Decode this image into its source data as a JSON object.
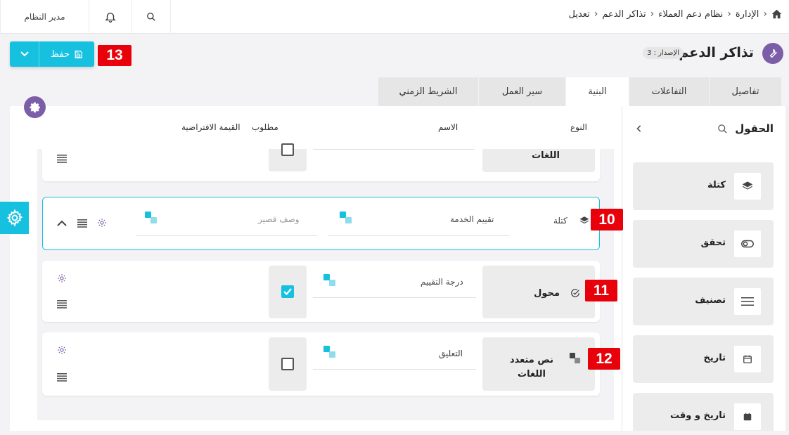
{
  "breadcrumbs": [
    "الإدارة",
    "نظام دعم العملاء",
    "تذاكر الدعم",
    "تعديل"
  ],
  "topbar": {
    "user_label": "مدير النظام"
  },
  "header": {
    "title": "تذاكر الدعم",
    "version": "الإصدار : 3",
    "save_label": "حفظ"
  },
  "tabs": [
    "تفاصيل",
    "التفاعلات",
    "البنية",
    "سير العمل",
    "الشريط الزمني"
  ],
  "active_tab": "البنية",
  "columns": {
    "type": "النوع",
    "name": "الاسم",
    "required": "مطلوب",
    "default": "القيمة الافتراضية"
  },
  "fields_panel": {
    "title": "الحقول",
    "items": [
      {
        "label": "كتلة",
        "icon": "layers-icon"
      },
      {
        "label": "تحقق",
        "icon": "toggle-icon"
      },
      {
        "label": "تصنيف",
        "icon": "menu-icon"
      },
      {
        "label": "تاريخ",
        "icon": "calendar-icon"
      },
      {
        "label": "تاريخ و وقت",
        "icon": "calendar-clock-icon"
      }
    ]
  },
  "rows": {
    "top_partial": {
      "type": "اللغات"
    },
    "block": {
      "type": "كتلة",
      "name": "تقييم الخدمة",
      "placeholder": "وصف قصير"
    },
    "switch": {
      "type": "محول",
      "name": "درجة التقييم",
      "required": true
    },
    "multilang": {
      "type": "نص متعدد اللغات",
      "name": "التعليق",
      "required": false
    }
  },
  "badges": {
    "save": "13",
    "block": "10",
    "switch": "11",
    "multilang": "12"
  },
  "colors": {
    "accent": "#16c1e0",
    "purple": "#7b5ea7",
    "badge": "#e8000a"
  }
}
